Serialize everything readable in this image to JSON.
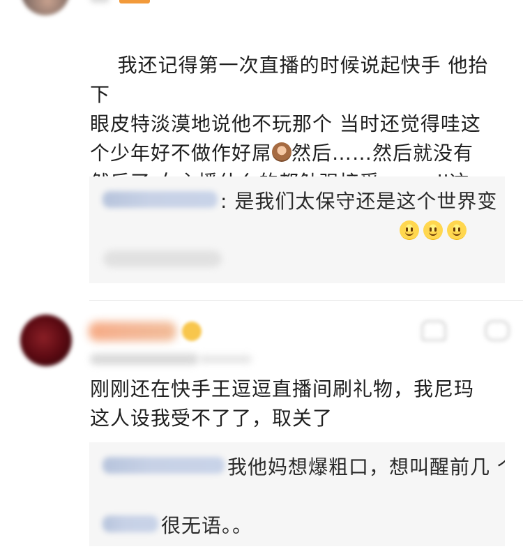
{
  "comments": [
    {
      "text": "我还记得第一次直播的时候说起快手 他抬下\n眼皮特淡漠地说他不玩那个 当时还觉得哇这\n个少年好不做作好屌",
      "text_after_emoji": "然后……然后就没有\n然后了 女主播什么的都勉强接受……wll这\n种……就算了吧",
      "emoji": "see-no-evil-monkey-icon",
      "replies": [
        {
          "text": ": 是我们太保守还是这个世界变\n了，感觉刷新三观了，果然我老了",
          "emoji": [
            "smile-icon",
            "smile-icon",
            "smile-icon"
          ]
        }
      ]
    },
    {
      "text": "刚刚还在快手王逗逗直播间刷礼物，我尼玛\n这人设我受不了了，取关了",
      "replies": [
        {
          "text": "我他妈想爆粗口，想叫醒前几\n个星期的自己"
        },
        {
          "text": "很无语。。"
        }
      ]
    }
  ],
  "colors": {
    "text": "#1f1f1f",
    "reply_background": "#f6f6f6",
    "link_blue": "#c7d1e6",
    "badge_orange": "#f29a3a",
    "name_orange": "#f3b08d"
  }
}
